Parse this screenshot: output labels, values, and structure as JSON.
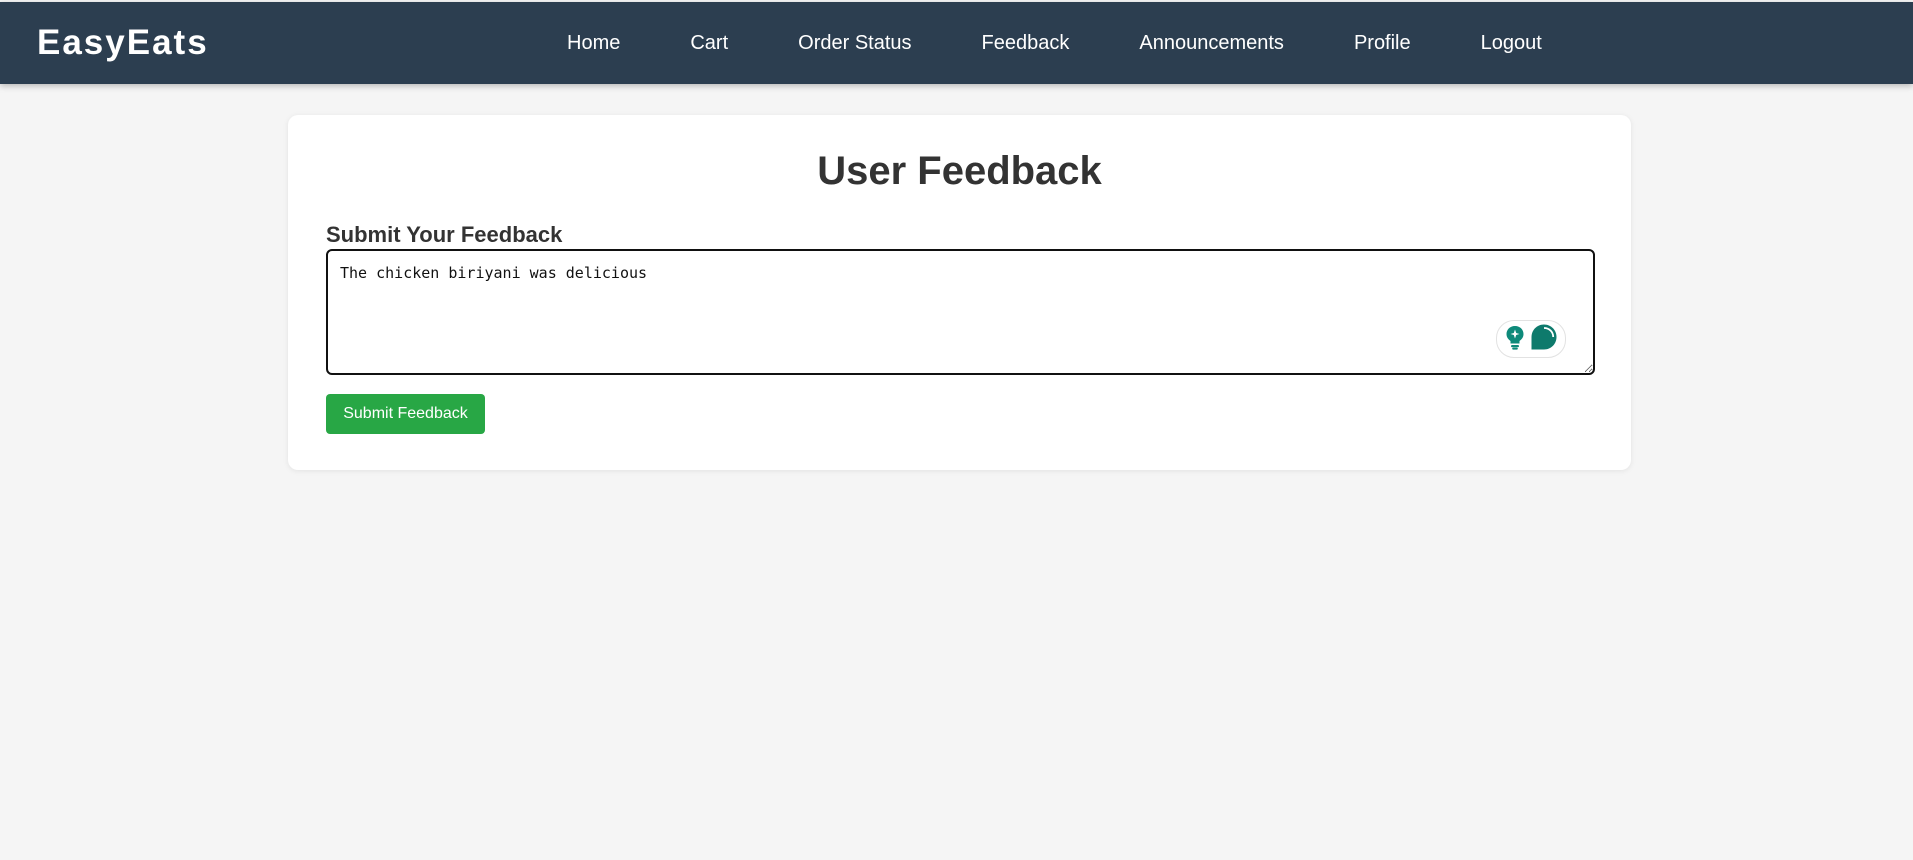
{
  "brand": {
    "name": "EasyEats"
  },
  "nav": {
    "links": [
      {
        "label": "Home"
      },
      {
        "label": "Cart"
      },
      {
        "label": "Order Status"
      },
      {
        "label": "Feedback"
      },
      {
        "label": "Announcements"
      },
      {
        "label": "Profile"
      },
      {
        "label": "Logout"
      }
    ]
  },
  "feedback": {
    "title": "User Feedback",
    "section_label": "Submit Your Feedback",
    "textarea_value": "The chicken biriyani was delicious",
    "submit_label": "Submit Feedback"
  },
  "assist_widget": {
    "icons": [
      "lightbulb-sparkle-icon",
      "chat-bubble-icon"
    ],
    "accent_color": "#0e8a7a"
  },
  "colors": {
    "navbar": "#2c3e50",
    "submit_button": "#28a745",
    "background": "#f5f5f5"
  }
}
